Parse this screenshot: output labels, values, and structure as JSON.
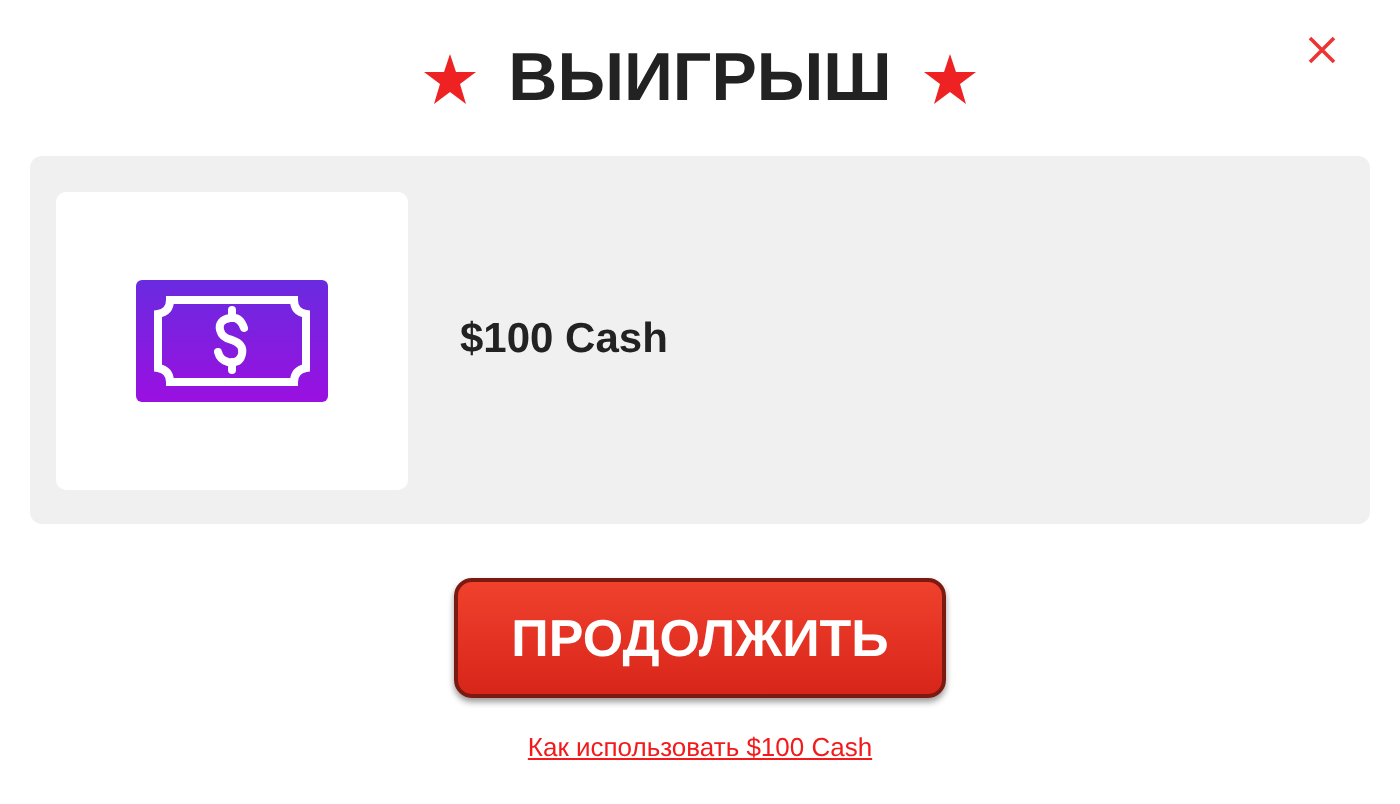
{
  "title": "ВЫИГРЫШ",
  "prize": {
    "label": "$100 Cash"
  },
  "button": "ПРОДОЛЖИТЬ",
  "link": "Как использовать $100 Cash"
}
